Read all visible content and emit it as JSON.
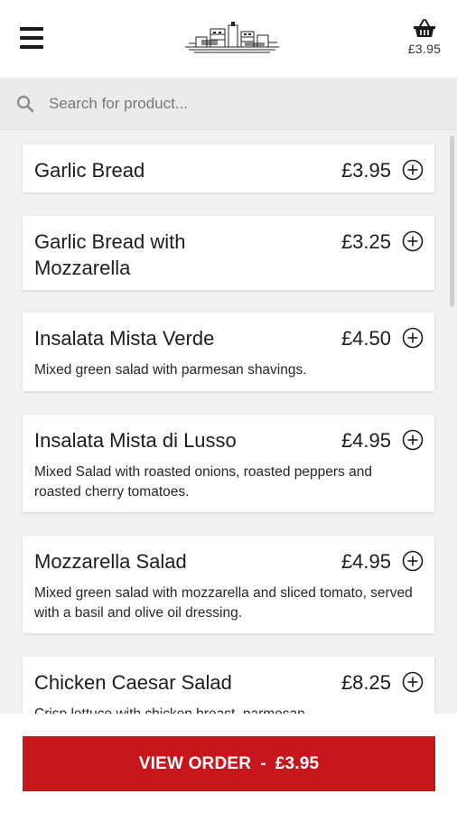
{
  "header": {
    "menu_icon": "hamburger-menu-icon",
    "logo_icon": "restaurant-logo-icon",
    "basket_icon": "basket-icon",
    "basket_total": "£3.95"
  },
  "search": {
    "placeholder": "Search for product...",
    "value": "",
    "icon": "search-icon"
  },
  "products": [
    {
      "name": "Garlic Bread",
      "price": "£3.95",
      "description": ""
    },
    {
      "name": "Garlic Bread with Mozzarella",
      "price": "£3.25",
      "description": ""
    },
    {
      "name": "Insalata Mista Verde",
      "price": "£4.50",
      "description": "Mixed green salad with parmesan shavings."
    },
    {
      "name": "Insalata Mista di Lusso",
      "price": "£4.95",
      "description": "Mixed Salad with roasted onions, roasted peppers and roasted cherry tomatoes."
    },
    {
      "name": "Mozzarella Salad",
      "price": "£4.95",
      "description": "Mixed green salad with mozzarella and sliced tomato, served with a basil and olive oil dressing."
    },
    {
      "name": "Chicken Caesar Salad",
      "price": "£8.25",
      "description": "Crisp lettuce with chicken breast, parmesan"
    }
  ],
  "footer": {
    "view_order_label": "VIEW ORDER",
    "separator": "-",
    "order_total": "£3.95"
  },
  "colors": {
    "accent": "#c8161d",
    "background": "#f1f1f1",
    "card": "#ffffff"
  }
}
